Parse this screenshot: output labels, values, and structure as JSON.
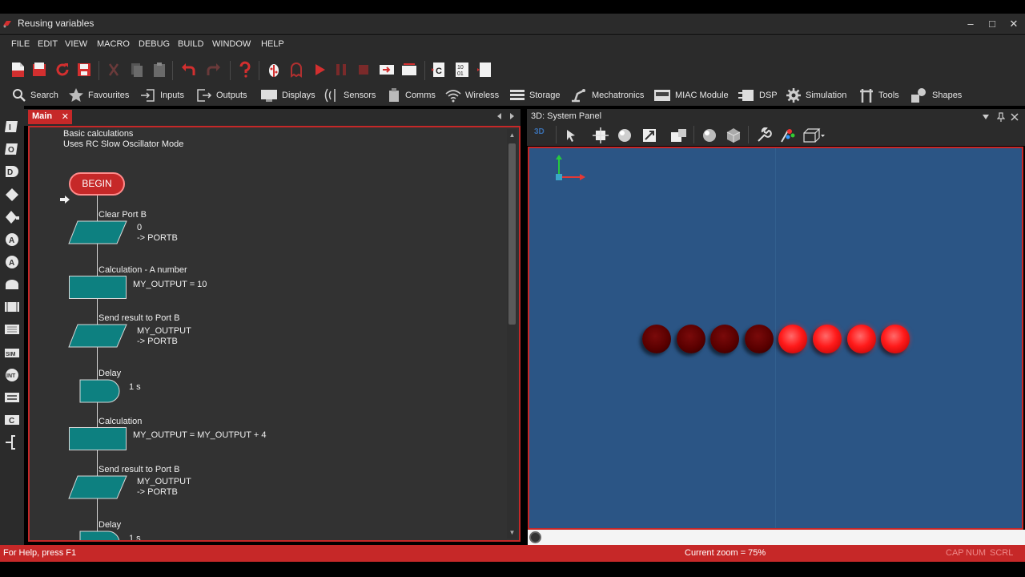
{
  "window": {
    "title": "Reusing variables",
    "controls": {
      "minimize": "–",
      "maximize": "□",
      "close": "✕"
    }
  },
  "menu": [
    "FILE",
    "EDIT",
    "VIEW",
    "MACRO",
    "DEBUG",
    "BUILD",
    "WINDOW",
    "HELP"
  ],
  "toolbar_component_groups": [
    {
      "label": "Search",
      "icon": "search-icon"
    },
    {
      "label": "Favourites",
      "icon": "star-icon"
    },
    {
      "label": "Inputs",
      "icon": "input-arrow-icon"
    },
    {
      "label": "Outputs",
      "icon": "output-arrow-icon"
    },
    {
      "label": "Displays",
      "icon": "display-icon"
    },
    {
      "label": "Sensors",
      "icon": "sensor-wave-icon"
    },
    {
      "label": "Comms",
      "icon": "comms-icon"
    },
    {
      "label": "Wireless",
      "icon": "wifi-icon"
    },
    {
      "label": "Storage",
      "icon": "storage-icon"
    },
    {
      "label": "Mechatronics",
      "icon": "robot-arm-icon"
    },
    {
      "label": "MIAC Module",
      "icon": "miac-icon"
    },
    {
      "label": "DSP",
      "icon": "dsp-icon"
    },
    {
      "label": "Simulation",
      "icon": "gear-icon"
    },
    {
      "label": "Tools",
      "icon": "tools-icon"
    },
    {
      "label": "Shapes",
      "icon": "shapes-icon"
    }
  ],
  "flowchart_panel": {
    "tab_label": "Main",
    "tab_close": "✕",
    "comment_line1": "Basic calculations",
    "comment_line2": "Uses RC Slow Oscillator Mode",
    "begin_label": "BEGIN",
    "blocks": [
      {
        "title": "Clear Port B",
        "line1": "0",
        "line2": "-> PORTB"
      },
      {
        "title": "Calculation - A number",
        "line1": "MY_OUTPUT = 10"
      },
      {
        "title": "Send result to Port B",
        "line1": "MY_OUTPUT",
        "line2": "-> PORTB"
      },
      {
        "title": "Delay",
        "line1": "1 s"
      },
      {
        "title": "Calculation",
        "line1": "MY_OUTPUT = MY_OUTPUT + 4"
      },
      {
        "title": "Send result to Port B",
        "line1": "MY_OUTPUT",
        "line2": "-> PORTB"
      },
      {
        "title": "Delay",
        "line1": "1 s"
      }
    ]
  },
  "system_panel": {
    "title": "3D: System Panel",
    "mode_label": "3D",
    "leds": [
      {
        "state": "off"
      },
      {
        "state": "off"
      },
      {
        "state": "off"
      },
      {
        "state": "off"
      },
      {
        "state": "on"
      },
      {
        "state": "on"
      },
      {
        "state": "on"
      },
      {
        "state": "on"
      }
    ]
  },
  "statusbar": {
    "help": "For Help, press F1",
    "zoom": "Current zoom = 75%",
    "cap": "CAP",
    "num": "NUM",
    "scrl": "SCRL"
  },
  "colors": {
    "accent": "#c62828",
    "flow_shape": "#0d8080",
    "sim_background": "#2b5585",
    "led_on": "#ff1a1a",
    "led_off": "#5a0000"
  }
}
